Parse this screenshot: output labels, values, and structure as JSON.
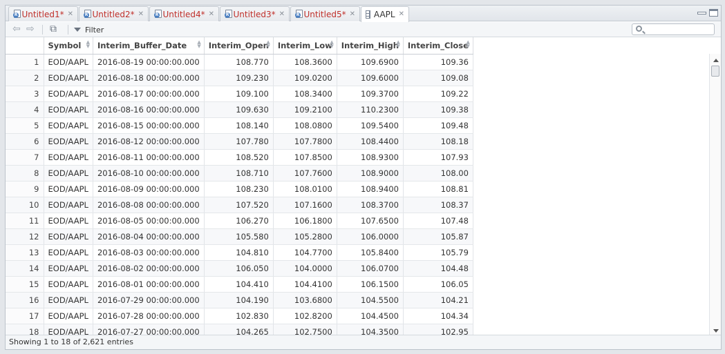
{
  "tabs": [
    {
      "label": "Untitled1*",
      "icon": "r-script-icon",
      "active": false
    },
    {
      "label": "Untitled2*",
      "icon": "r-script-icon",
      "active": false
    },
    {
      "label": "Untitled4*",
      "icon": "r-script-icon",
      "active": false
    },
    {
      "label": "Untitled3*",
      "icon": "r-script-icon",
      "active": false
    },
    {
      "label": "Untitled5*",
      "icon": "r-script-icon",
      "active": false
    },
    {
      "label": "AAPL",
      "icon": "data-grid-icon",
      "active": true
    }
  ],
  "toolbar": {
    "filter_label": "Filter",
    "search_value": "",
    "search_placeholder": ""
  },
  "table": {
    "columns": [
      "",
      "Symbol",
      "Interim_Buffer_Date",
      "Interim_Open",
      "Interim_Low",
      "Interim_High",
      "Interim_Close"
    ],
    "rows": [
      [
        "1",
        "EOD/AAPL",
        "2016-08-19 00:00:00.000",
        "108.770",
        "108.3600",
        "109.6900",
        "109.36"
      ],
      [
        "2",
        "EOD/AAPL",
        "2016-08-18 00:00:00.000",
        "109.230",
        "109.0200",
        "109.6000",
        "109.08"
      ],
      [
        "3",
        "EOD/AAPL",
        "2016-08-17 00:00:00.000",
        "109.100",
        "108.3400",
        "109.3700",
        "109.22"
      ],
      [
        "4",
        "EOD/AAPL",
        "2016-08-16 00:00:00.000",
        "109.630",
        "109.2100",
        "110.2300",
        "109.38"
      ],
      [
        "5",
        "EOD/AAPL",
        "2016-08-15 00:00:00.000",
        "108.140",
        "108.0800",
        "109.5400",
        "109.48"
      ],
      [
        "6",
        "EOD/AAPL",
        "2016-08-12 00:00:00.000",
        "107.780",
        "107.7800",
        "108.4400",
        "108.18"
      ],
      [
        "7",
        "EOD/AAPL",
        "2016-08-11 00:00:00.000",
        "108.520",
        "107.8500",
        "108.9300",
        "107.93"
      ],
      [
        "8",
        "EOD/AAPL",
        "2016-08-10 00:00:00.000",
        "108.710",
        "107.7600",
        "108.9000",
        "108.00"
      ],
      [
        "9",
        "EOD/AAPL",
        "2016-08-09 00:00:00.000",
        "108.230",
        "108.0100",
        "108.9400",
        "108.81"
      ],
      [
        "10",
        "EOD/AAPL",
        "2016-08-08 00:00:00.000",
        "107.520",
        "107.1600",
        "108.3700",
        "108.37"
      ],
      [
        "11",
        "EOD/AAPL",
        "2016-08-05 00:00:00.000",
        "106.270",
        "106.1800",
        "107.6500",
        "107.48"
      ],
      [
        "12",
        "EOD/AAPL",
        "2016-08-04 00:00:00.000",
        "105.580",
        "105.2800",
        "106.0000",
        "105.87"
      ],
      [
        "13",
        "EOD/AAPL",
        "2016-08-03 00:00:00.000",
        "104.810",
        "104.7700",
        "105.8400",
        "105.79"
      ],
      [
        "14",
        "EOD/AAPL",
        "2016-08-02 00:00:00.000",
        "106.050",
        "104.0000",
        "106.0700",
        "104.48"
      ],
      [
        "15",
        "EOD/AAPL",
        "2016-08-01 00:00:00.000",
        "104.410",
        "104.4100",
        "106.1500",
        "106.05"
      ],
      [
        "16",
        "EOD/AAPL",
        "2016-07-29 00:00:00.000",
        "104.190",
        "103.6800",
        "104.5500",
        "104.21"
      ],
      [
        "17",
        "EOD/AAPL",
        "2016-07-28 00:00:00.000",
        "102.830",
        "102.8200",
        "104.4500",
        "104.34"
      ],
      [
        "18",
        "EOD/AAPL",
        "2016-07-27 00:00:00.000",
        "104.265",
        "102.7500",
        "104.3500",
        "102.95"
      ]
    ]
  },
  "footer": {
    "status": "Showing 1 to 18 of 2,621 entries"
  }
}
